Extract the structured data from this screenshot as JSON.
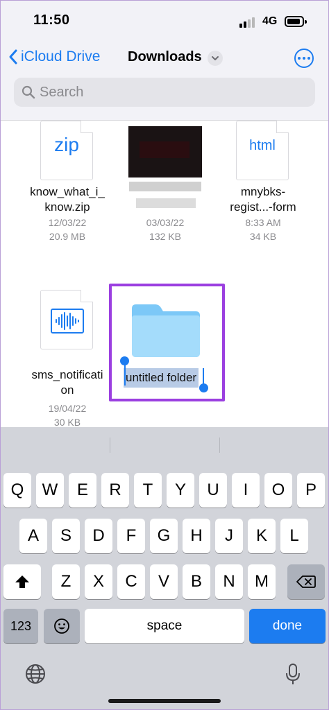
{
  "status_bar": {
    "time": "11:50",
    "network": "4G"
  },
  "nav": {
    "back_label": "iCloud Drive",
    "title": "Downloads"
  },
  "search": {
    "placeholder": "Search"
  },
  "files": [
    {
      "ext": "zip",
      "name_line1": "know_what_i_",
      "name_line2": "know.zip",
      "date": "12/03/22",
      "size": "20.9 MB"
    },
    {
      "date": "03/03/22",
      "size": "132 KB"
    },
    {
      "ext": "html",
      "name_line1": "mnybks-",
      "name_line2": "regist...-form",
      "date": "8:33 AM",
      "size": "34 KB"
    },
    {
      "name_line1": "sms_notificati",
      "name_line2": "on",
      "date": "19/04/22",
      "size": "30 KB"
    },
    {
      "rename_value": "untitled folder"
    }
  ],
  "keyboard": {
    "row1": [
      "Q",
      "W",
      "E",
      "R",
      "T",
      "Y",
      "U",
      "I",
      "O",
      "P"
    ],
    "row2": [
      "A",
      "S",
      "D",
      "F",
      "G",
      "H",
      "J",
      "K",
      "L"
    ],
    "row3": [
      "Z",
      "X",
      "C",
      "V",
      "B",
      "N",
      "M"
    ],
    "numbers_label": "123",
    "space_label": "space",
    "done_label": "done"
  },
  "colors": {
    "accent": "#1c7cf0",
    "selection_border": "#9b3fe0",
    "keyboard_bg": "#d2d4da"
  },
  "icons": [
    "signal-icon",
    "battery-icon",
    "back-chevron-icon",
    "chevron-down-icon",
    "more-icon",
    "search-icon",
    "audio-file-icon",
    "folder-icon",
    "shift-icon",
    "delete-icon",
    "emoji-icon",
    "globe-icon",
    "microphone-icon"
  ]
}
